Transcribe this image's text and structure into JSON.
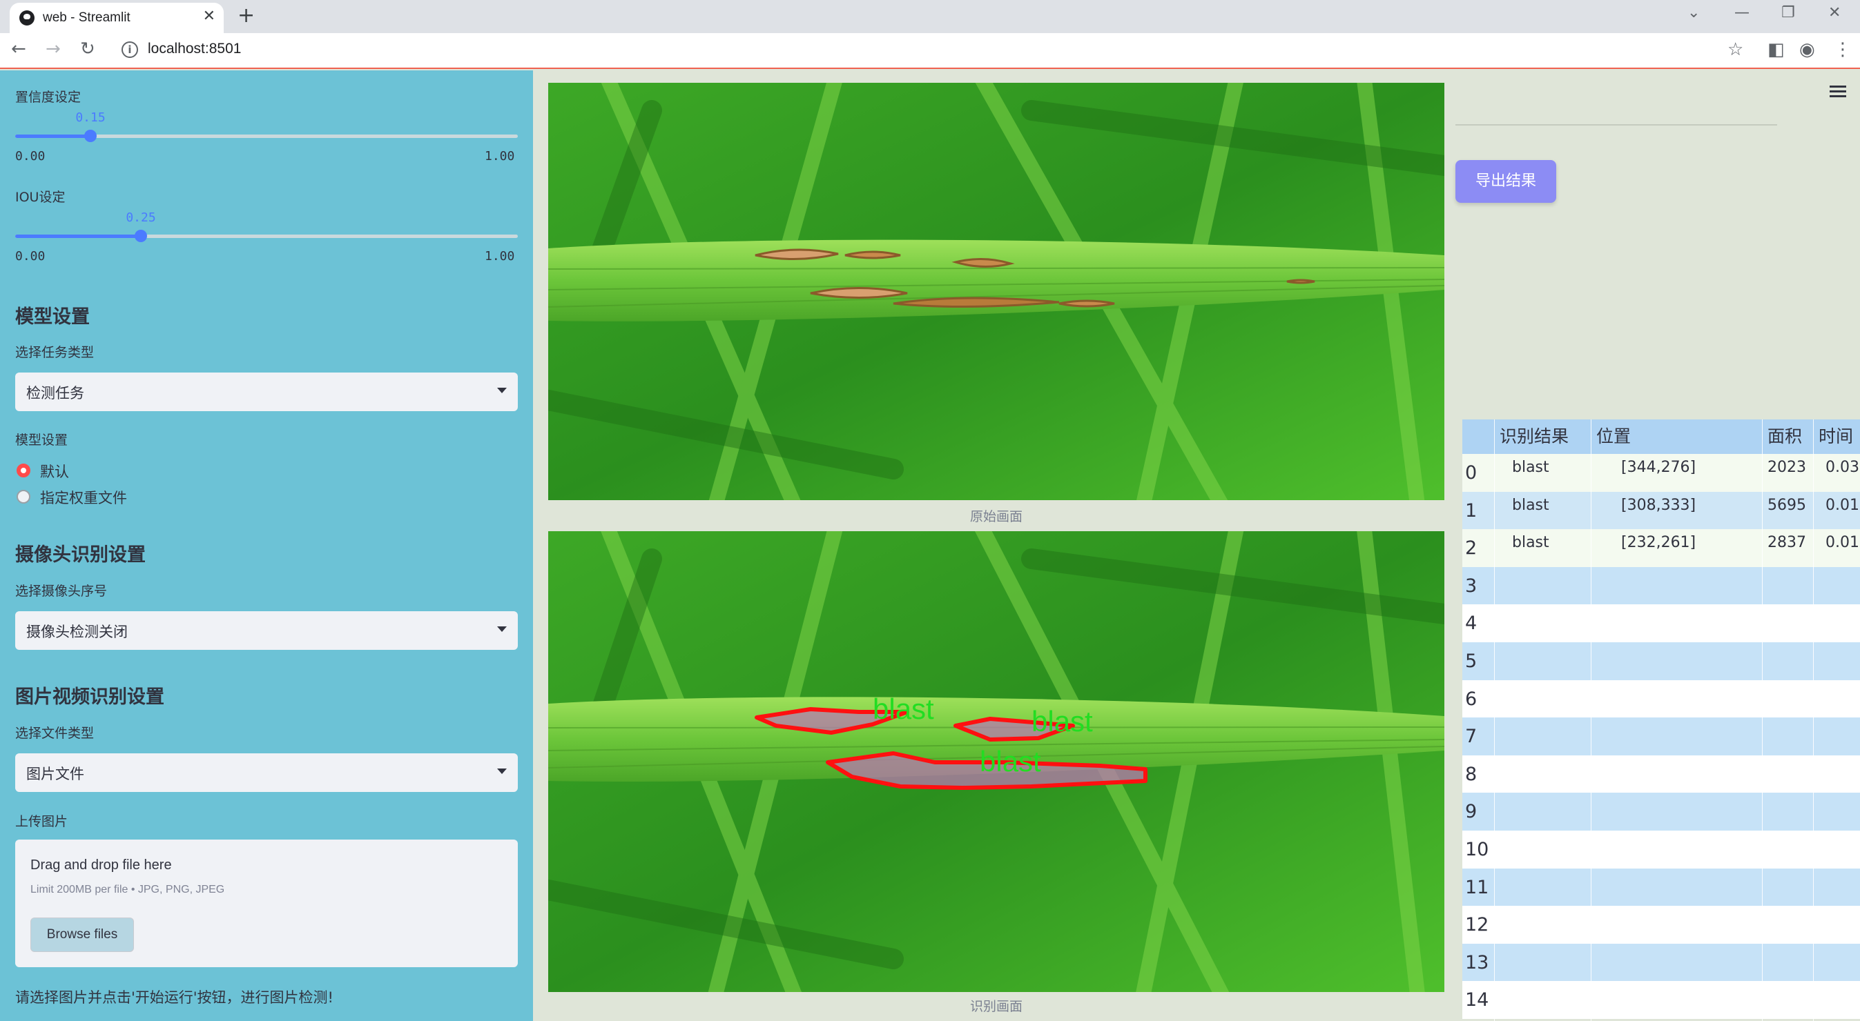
{
  "browser": {
    "tab_title": "web - Streamlit",
    "url": "localhost:8501"
  },
  "sidebar": {
    "conf": {
      "label": "置信度设定",
      "value": "0.15",
      "value_num": 0.15,
      "min": "0.00",
      "max": "1.00"
    },
    "iou": {
      "label": "IOU设定",
      "value": "0.25",
      "value_num": 0.25,
      "min": "0.00",
      "max": "1.00"
    },
    "model_header": "模型设置",
    "task_label": "选择任务类型",
    "task_value": "检测任务",
    "model_label": "模型设置",
    "model_options": [
      "默认",
      "指定权重文件"
    ],
    "camera_header": "摄像头识别设置",
    "camera_label": "选择摄像头序号",
    "camera_value": "摄像头检测关闭",
    "media_header": "图片视频识别设置",
    "filetype_label": "选择文件类型",
    "filetype_value": "图片文件",
    "upload_label": "上传图片",
    "upload_title": "Drag and drop file here",
    "upload_limit": "Limit 200MB per file • JPG, PNG, JPEG",
    "browse_label": "Browse files",
    "hint": "请选择图片并点击'开始运行'按钮，进行图片检测!"
  },
  "main": {
    "original_caption": "原始画面",
    "result_caption": "识别画面",
    "detection_labels": [
      "blast",
      "blast",
      "blast"
    ]
  },
  "right": {
    "export_label": "导出结果",
    "table": {
      "headers": [
        "",
        "识别结果",
        "位置",
        "面积",
        "时间"
      ],
      "rows": [
        {
          "idx": "0",
          "result": "blast",
          "pos": "[344,276]",
          "area": "2023",
          "time": "0.03"
        },
        {
          "idx": "1",
          "result": "blast",
          "pos": "[308,333]",
          "area": "5695",
          "time": "0.01"
        },
        {
          "idx": "2",
          "result": "blast",
          "pos": "[232,261]",
          "area": "2837",
          "time": "0.01"
        },
        {
          "idx": "3"
        },
        {
          "idx": "4"
        },
        {
          "idx": "5"
        },
        {
          "idx": "6"
        },
        {
          "idx": "7"
        },
        {
          "idx": "8"
        },
        {
          "idx": "9"
        },
        {
          "idx": "10"
        },
        {
          "idx": "11"
        },
        {
          "idx": "12"
        },
        {
          "idx": "13"
        },
        {
          "idx": "14"
        }
      ]
    }
  },
  "colors": {
    "sidebar_bg": "#6cc2d6",
    "accent": "#4b7bff",
    "export_button": "#8c8cf4",
    "table_header": "#aed3f3",
    "detection_outline": "#ff1010",
    "detection_label": "#22dd22"
  }
}
